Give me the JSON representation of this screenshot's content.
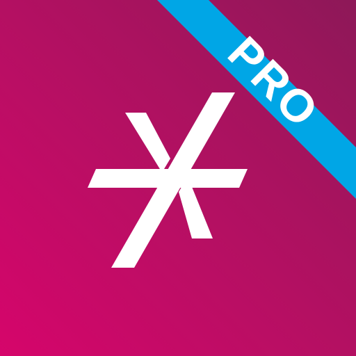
{
  "app_icon": {
    "badge": {
      "label": "PRO"
    },
    "colors": {
      "gradient_start": "#d6056b",
      "gradient_end": "#8d1858",
      "ribbon": "#00a6e6",
      "mark": "#ffffff",
      "badge_text": "#ffffff"
    },
    "mark_icon": "asterisk-icon"
  }
}
